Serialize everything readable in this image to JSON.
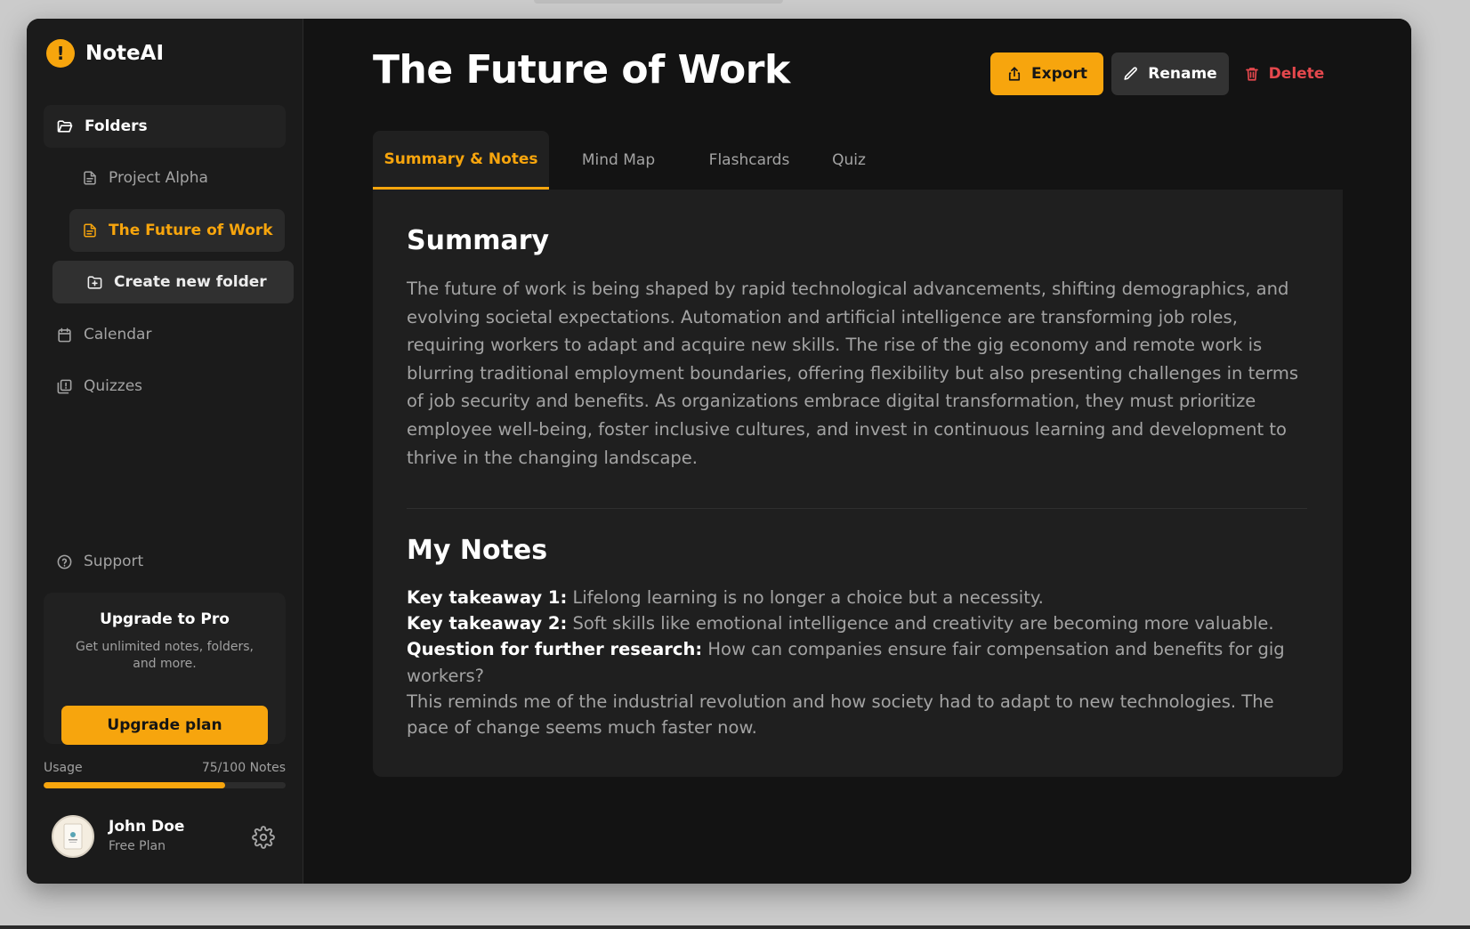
{
  "app": {
    "name": "NoteAI"
  },
  "sidebar": {
    "folders_label": "Folders",
    "folder_items": [
      {
        "label": "Project Alpha"
      },
      {
        "label": "The Future of Work"
      }
    ],
    "create_folder_label": "Create new folder",
    "calendar_label": "Calendar",
    "quizzes_label": "Quizzes",
    "support_label": "Support",
    "upgrade": {
      "title": "Upgrade to Pro",
      "text": "Get unlimited notes, folders, and more.",
      "button_label": "Upgrade plan"
    },
    "usage": {
      "label": "Usage",
      "count": "75/100 Notes",
      "used": 75,
      "total": 100
    },
    "user": {
      "name": "John Doe",
      "plan": "Free Plan"
    }
  },
  "header": {
    "title": "The Future of Work",
    "export_label": "Export",
    "rename_label": "Rename",
    "delete_label": "Delete"
  },
  "tabs": [
    {
      "label": "Summary & Notes",
      "active": true
    },
    {
      "label": "Mind Map",
      "active": false
    },
    {
      "label": "Flashcards",
      "active": false
    },
    {
      "label": "Quiz",
      "active": false
    }
  ],
  "summary": {
    "heading": "Summary",
    "text": "The future of work is being shaped by rapid technological advancements, shifting demographics, and evolving societal expectations. Automation and artificial intelligence are transforming job roles, requiring workers to adapt and acquire new skills. The rise of the gig economy and remote work is blurring traditional employment boundaries, offering flexibility but also presenting challenges in terms of job security and benefits. As organizations embrace digital transformation, they must prioritize employee well-being, foster inclusive cultures, and invest in continuous learning and development to thrive in the changing landscape."
  },
  "notes": {
    "heading": "My Notes",
    "items": [
      {
        "label": "Key takeaway 1:",
        "text": "Lifelong learning is no longer a choice but a necessity."
      },
      {
        "label": "Key takeaway 2:",
        "text": "Soft skills like emotional intelligence and creativity are becoming more valuable."
      },
      {
        "label": "Question for further research:",
        "text": "How can companies ensure fair compensation and benefits for gig workers?"
      }
    ],
    "paragraph": "This reminds me of the industrial revolution and how society had to adapt to new technologies. The pace of change seems much faster now."
  },
  "colors": {
    "accent": "#f7a50d",
    "danger": "#e5484d",
    "background": "#131313",
    "sidebar": "#1b1b1b",
    "card": "#1f1f1f"
  },
  "icons": {
    "brand": "alert-circle-icon",
    "folders": "folder-open-icon",
    "file": "file-text-icon",
    "create_folder": "folder-plus-icon",
    "calendar": "calendar-icon",
    "quizzes": "quiz-book-icon",
    "support": "help-circle-icon",
    "settings": "gear-icon",
    "export": "share-icon",
    "rename": "pencil-icon",
    "delete": "trash-icon"
  }
}
